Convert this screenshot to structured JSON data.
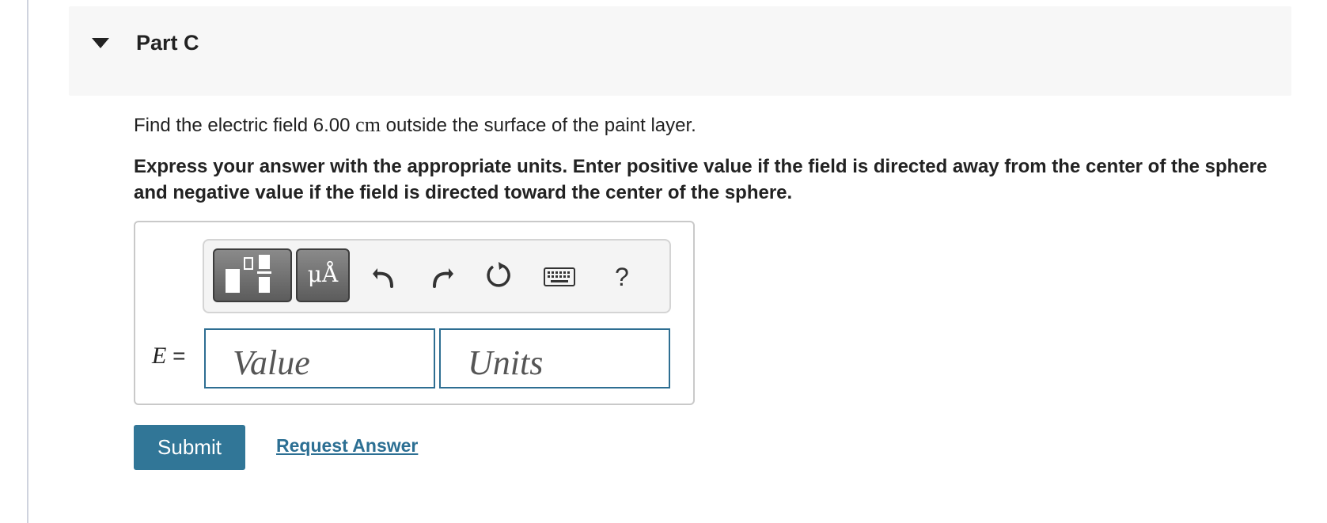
{
  "part": {
    "title": "Part C"
  },
  "question": {
    "text_before": "Find the electric field 6.00 ",
    "unit": "cm",
    "text_after": " outside the surface of the paint layer."
  },
  "instructions": "Express your answer with the appropriate units. Enter positive value if the field is directed away from the center of the sphere and negative value if the field is directed toward the center of the sphere.",
  "toolbar": {
    "units_label": "μÅ",
    "help_label": "?",
    "icons": [
      "templates-icon",
      "units-icon",
      "undo-icon",
      "redo-icon",
      "reset-icon",
      "keyboard-icon",
      "help-icon"
    ]
  },
  "answer": {
    "variable": "E",
    "equals": " =",
    "value_placeholder": "Value",
    "units_placeholder": "Units"
  },
  "actions": {
    "submit_label": "Submit",
    "request_label": "Request Answer"
  },
  "colors": {
    "accent": "#317697",
    "link": "#2c6f93",
    "field_border": "#2e6e92",
    "header_bg": "#f7f7f7"
  }
}
